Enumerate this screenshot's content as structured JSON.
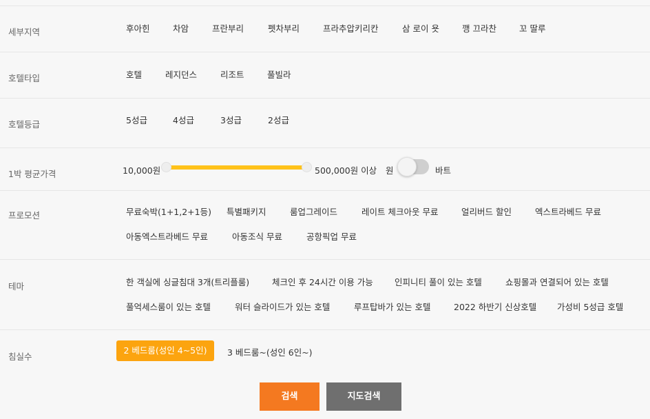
{
  "filters": {
    "district": {
      "label": "세부지역",
      "options": [
        "후아힌",
        "차암",
        "프란부리",
        "펫차부리",
        "프라추압키리칸",
        "삼 로이 욧",
        "깽 끄라찬",
        "꼬 딸루"
      ]
    },
    "hotel_type": {
      "label": "호텔타입",
      "options": [
        "호텔",
        "레지던스",
        "리조트",
        "풀빌라"
      ]
    },
    "hotel_grade": {
      "label": "호텔등급",
      "options": [
        "5성급",
        "4성급",
        "3성급",
        "2성급"
      ]
    },
    "price": {
      "label": "1박 평균가격",
      "min_label": "10,000원",
      "max_label": "500,000원 이상",
      "currency_left": "원",
      "currency_right": "바트"
    },
    "promotion": {
      "label": "프로모션",
      "options": [
        "무료숙박(1+1,2+1등)",
        "특별패키지",
        "룸업그레이드",
        "레이트 체크아웃 무료",
        "얼리버드 할인",
        "엑스트라베드 무료",
        "아동엑스트라베드 무료",
        "아동조식 무료",
        "공항픽업 무료"
      ]
    },
    "theme": {
      "label": "테마",
      "options": [
        "한 객실에 싱글침대 3개(트리플룸)",
        "체크인 후 24시간 이용 가능",
        "인피니티 풀이 있는 호텔",
        "쇼핑몰과 연결되어 있는 호텔",
        "풀억세스룸이 있는 호텔",
        "워터 슬라이드가 있는 호텔",
        "루프탑바가 있는 호텔",
        "2022 하반기 신상호텔",
        "가성비 5성급 호텔"
      ]
    },
    "bedrooms": {
      "label": "침실수",
      "options": [
        "2 베드룸(성인 4~5인)",
        "3 베드룸~(성인 6인~)"
      ],
      "selected": "2 베드룸(성인 4~5인)"
    }
  },
  "buttons": {
    "search": "검색",
    "map_search": "지도검색"
  },
  "colors": {
    "slider": "#ffc21a",
    "selected": "#fca40f",
    "search": "#f47920",
    "map_search": "#6f6f6f"
  }
}
